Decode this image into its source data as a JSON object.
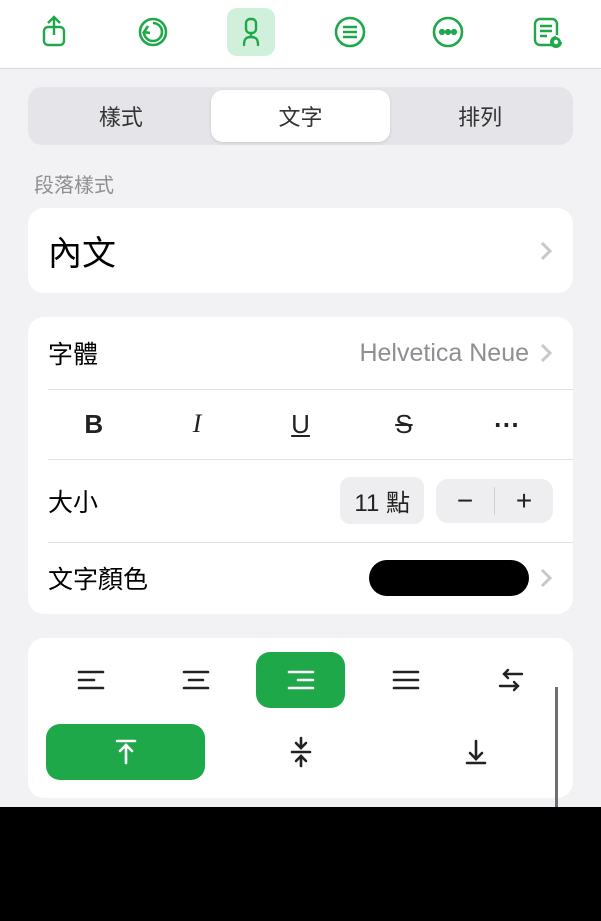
{
  "toolbar": {
    "share": "share-icon",
    "undo": "undo-icon",
    "format": "brush-icon",
    "menu": "menu-icon",
    "more": "more-icon",
    "presenter": "presenter-icon"
  },
  "tabs": {
    "style": "樣式",
    "text": "文字",
    "arrange": "排列"
  },
  "section": {
    "paragraph_style_label": "段落樣式",
    "paragraph_style_value": "內文"
  },
  "font": {
    "label": "字體",
    "value": "Helvetica Neue"
  },
  "style_buttons": {
    "bold": "B",
    "italic": "I",
    "underline": "U",
    "strike": "S",
    "more": "⋯"
  },
  "size": {
    "label": "大小",
    "value": "11 點",
    "minus": "−",
    "plus": "+"
  },
  "text_color": {
    "label": "文字顏色",
    "value": "#000000"
  },
  "align": {
    "left": "align-left",
    "center": "align-center",
    "right": "align-right",
    "justify": "align-justify",
    "direction": "text-direction",
    "top": "align-top",
    "middle": "align-middle",
    "bottom": "align-bottom"
  }
}
